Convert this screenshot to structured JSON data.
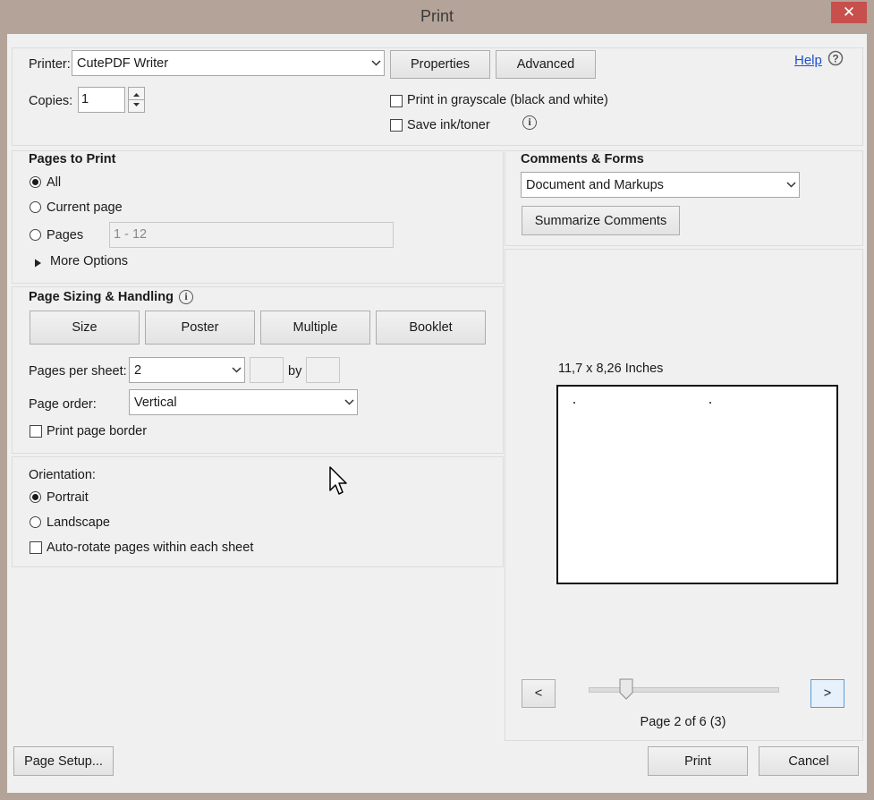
{
  "window": {
    "title": "Print",
    "close_glyph": "✕"
  },
  "printer": {
    "label": "Printer:",
    "value": "CutePDF Writer",
    "properties_label": "Properties",
    "advanced_label": "Advanced",
    "help_label": "Help",
    "copies_label": "Copies:",
    "copies_value": "1",
    "grayscale_label": "Print in grayscale (black and white)",
    "grayscale_checked": false,
    "save_ink_label": "Save ink/toner",
    "save_ink_checked": false
  },
  "pages_to_print": {
    "heading": "Pages to Print",
    "all_label": "All",
    "current_label": "Current page",
    "pages_label": "Pages",
    "pages_range": "1 - 12",
    "selected": "All",
    "more_options_label": "More Options"
  },
  "sizing": {
    "heading": "Page Sizing & Handling",
    "size_btn": "Size",
    "poster_btn": "Poster",
    "multiple_btn": "Multiple",
    "booklet_btn": "Booklet",
    "pages_per_sheet_label": "Pages per sheet:",
    "pages_per_sheet_value": "2",
    "by_label": "by",
    "page_order_label": "Page order:",
    "page_order_value": "Vertical",
    "print_border_label": "Print page border",
    "print_border_checked": false
  },
  "orientation": {
    "heading": "Orientation:",
    "portrait_label": "Portrait",
    "landscape_label": "Landscape",
    "selected": "Portrait",
    "auto_rotate_label": "Auto-rotate pages within each sheet",
    "auto_rotate_checked": false
  },
  "comments_forms": {
    "heading": "Comments & Forms",
    "value": "Document and Markups",
    "summarize_label": "Summarize Comments"
  },
  "preview": {
    "size_label": "11,7 x 8,26 Inches",
    "prev_label": "<",
    "next_label": ">",
    "page_info": "Page 2 of 6 (3)",
    "slider_fraction": 0.2
  },
  "footer": {
    "page_setup_label": "Page Setup...",
    "print_label": "Print",
    "cancel_label": "Cancel"
  },
  "icons": {
    "dropdown": "chevron-down-icon",
    "info": "info-icon",
    "help": "question-circle-icon",
    "disclosure": "triangle-right-icon"
  }
}
